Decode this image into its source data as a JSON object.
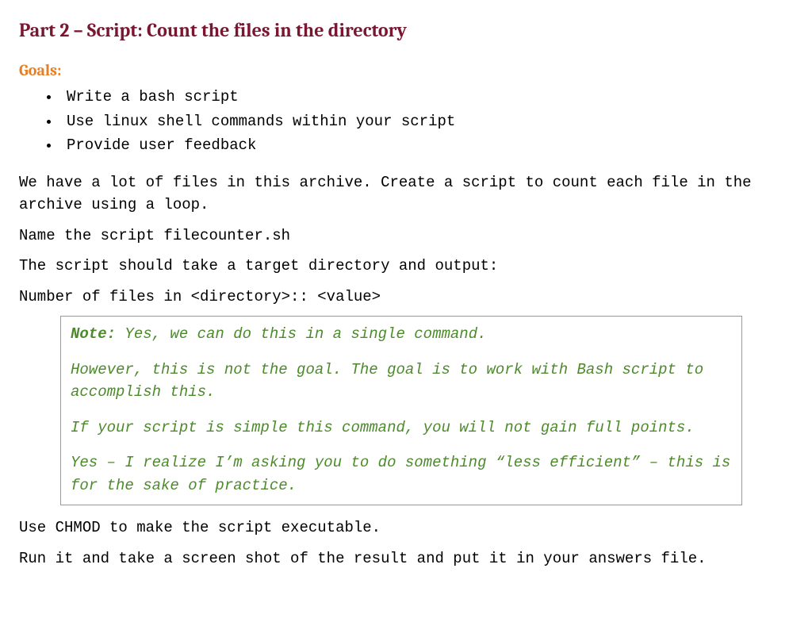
{
  "title": "Part 2 – Script: Count the files in the directory",
  "goalsHeading": "Goals:",
  "goals": [
    "Write a bash script",
    "Use linux shell commands within your script",
    "Provide user feedback"
  ],
  "intro": "We have a lot of files in this archive.  Create a script to count each file in the archive using a loop.",
  "nameLine": "Name the script filecounter.sh",
  "targetLine": "The script should take a target directory and output:",
  "outputLine": "Number of files in <directory>:: <value>",
  "note": {
    "label": "Note:",
    "line1": " Yes, we can do this in a single command.",
    "line2": "However, this is not the goal.  The goal is to work with Bash script to accomplish this.",
    "line3": "If your script is simple this command, you will not gain full points.",
    "line4": "Yes – I realize I’m asking you to do something “less efficient” – this is for the sake of practice."
  },
  "chmodLine": "Use CHMOD to make the script executable.",
  "runLine": "Run it and take a screen shot of the result and put it in your answers file."
}
